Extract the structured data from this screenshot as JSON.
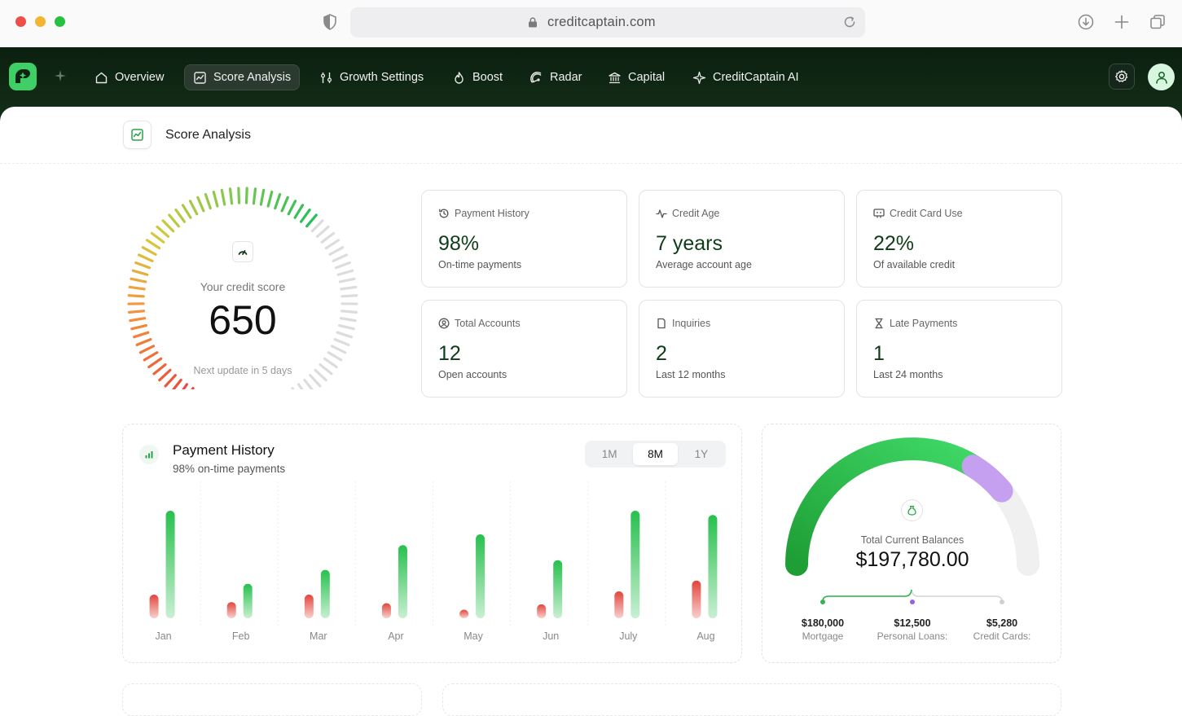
{
  "browser": {
    "url": "creditcaptain.com"
  },
  "nav": {
    "items": [
      {
        "label": "Overview",
        "icon": "home-icon"
      },
      {
        "label": "Score Analysis",
        "icon": "chart-icon",
        "active": true
      },
      {
        "label": "Growth Settings",
        "icon": "sliders-icon"
      },
      {
        "label": "Boost",
        "icon": "flame-icon"
      },
      {
        "label": "Radar",
        "icon": "radar-icon"
      },
      {
        "label": "Capital",
        "icon": "bank-icon"
      },
      {
        "label": "CreditCaptain AI",
        "icon": "sparkle-icon"
      }
    ]
  },
  "page": {
    "title": "Score Analysis"
  },
  "score": {
    "label": "Your credit score",
    "value": "650",
    "next_update": "Next update in 5 days"
  },
  "stats": [
    {
      "title": "Payment History",
      "value": "98%",
      "sub": "On-time payments",
      "icon": "history-icon"
    },
    {
      "title": "Credit Age",
      "value": "7 years",
      "sub": "Average account age",
      "icon": "activity-icon"
    },
    {
      "title": "Credit Card Use",
      "value": "22%",
      "sub": "Of available credit",
      "icon": "card-icon"
    },
    {
      "title": "Total Accounts",
      "value": "12",
      "sub": "Open accounts",
      "icon": "user-circle-icon"
    },
    {
      "title": "Inquiries",
      "value": "2",
      "sub": "Last 12 months",
      "icon": "document-icon"
    },
    {
      "title": "Late Payments",
      "value": "1",
      "sub": "Last 24 months",
      "icon": "hourglass-icon"
    }
  ],
  "payment_history": {
    "title": "Payment History",
    "subtitle": "98% on-time payments",
    "ranges": [
      "1M",
      "8M",
      "1Y"
    ],
    "active_range": "8M"
  },
  "chart_data": {
    "type": "bar",
    "categories": [
      "Jan",
      "Feb",
      "Mar",
      "Apr",
      "May",
      "Jun",
      "July",
      "Aug"
    ],
    "series": [
      {
        "values": [
          22,
          15,
          22,
          14,
          8,
          13,
          25,
          35
        ]
      },
      {
        "values": [
          100,
          32,
          45,
          68,
          78,
          54,
          100,
          96
        ]
      }
    ],
    "colors": {
      "late": "#e2453c",
      "ontime": "#27c04d"
    }
  },
  "balances": {
    "label": "Total Current Balances",
    "value": "$197,780.00",
    "items": [
      {
        "amount": "$180,000",
        "name": "Mortgage"
      },
      {
        "amount": "$12,500",
        "name": "Personal Loans:"
      },
      {
        "amount": "$5,280",
        "name": "Credit Cards:"
      }
    ]
  }
}
